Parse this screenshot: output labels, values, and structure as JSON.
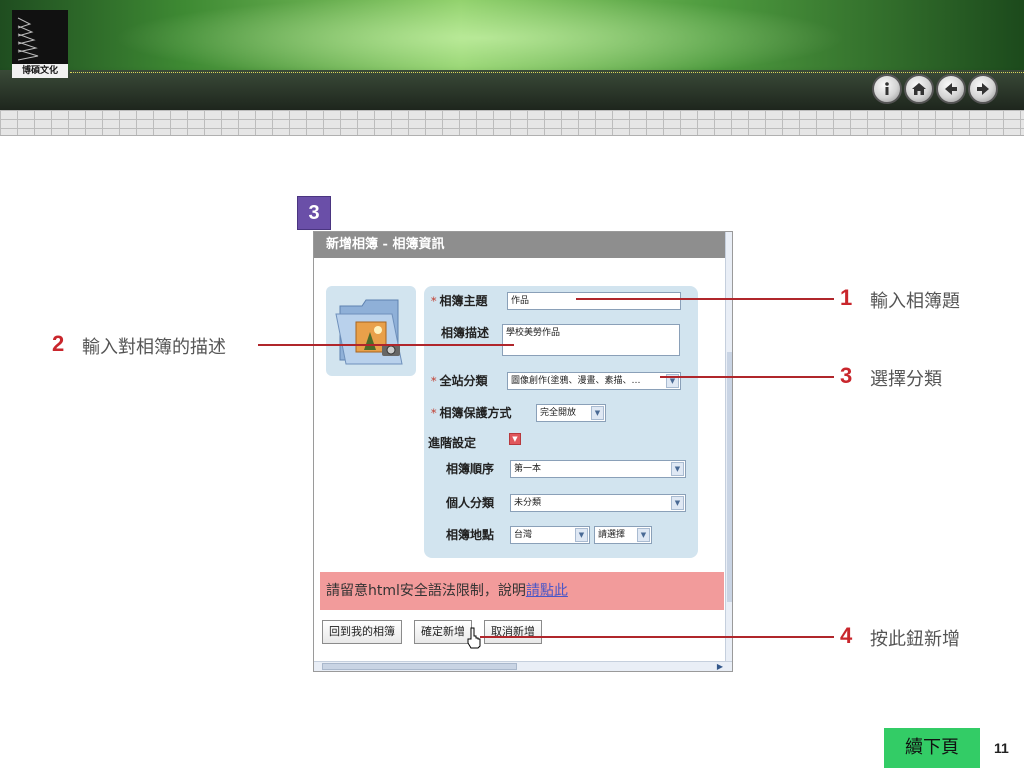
{
  "brand": {
    "logo_text": "博碩文化"
  },
  "nav": {
    "buttons": [
      {
        "name": "info-button",
        "icon": "info-icon"
      },
      {
        "name": "home-button",
        "icon": "home-icon"
      },
      {
        "name": "back-button",
        "icon": "arrow-left-icon"
      },
      {
        "name": "forward-button",
        "icon": "arrow-right-icon"
      }
    ]
  },
  "step_badge": "3",
  "form": {
    "window_title": "新增相簿 - 相簿資訊",
    "fields": {
      "title": {
        "label": "相簿主題",
        "value": "作品",
        "required": "*"
      },
      "description": {
        "label": "相簿描述",
        "value": "學校美勞作品"
      },
      "category": {
        "label": "全站分類",
        "value": "圖像創作(塗鴉、漫畫、素描、…",
        "required": "*"
      },
      "privacy": {
        "label": "相簿保護方式",
        "value": "完全開放",
        "required": "*"
      },
      "advanced": {
        "label": "進階設定"
      },
      "order": {
        "label": "相簿順序",
        "value": "第一本"
      },
      "personal_category": {
        "label": "個人分類",
        "value": "未分類"
      },
      "location": {
        "label": "相簿地點",
        "value": "台灣",
        "value2": "請選擇"
      }
    },
    "notice": {
      "text": "請留意html安全語法限制，說明",
      "link": "請點此"
    },
    "buttons": {
      "back": "回到我的相簿",
      "confirm": "確定新增",
      "cancel": "取消新增"
    }
  },
  "callouts": [
    {
      "num": "1",
      "text": "輸入相簿題"
    },
    {
      "num": "2",
      "text": "輸入對相簿的描述"
    },
    {
      "num": "3",
      "text": "選擇分類"
    },
    {
      "num": "4",
      "text": "按此鈕新增"
    }
  ],
  "footer": {
    "next": "續下頁",
    "page": "11"
  },
  "colors": {
    "accent_red": "#c9262c",
    "badge_purple": "#6a4fa8",
    "next_green": "#33cc66"
  }
}
